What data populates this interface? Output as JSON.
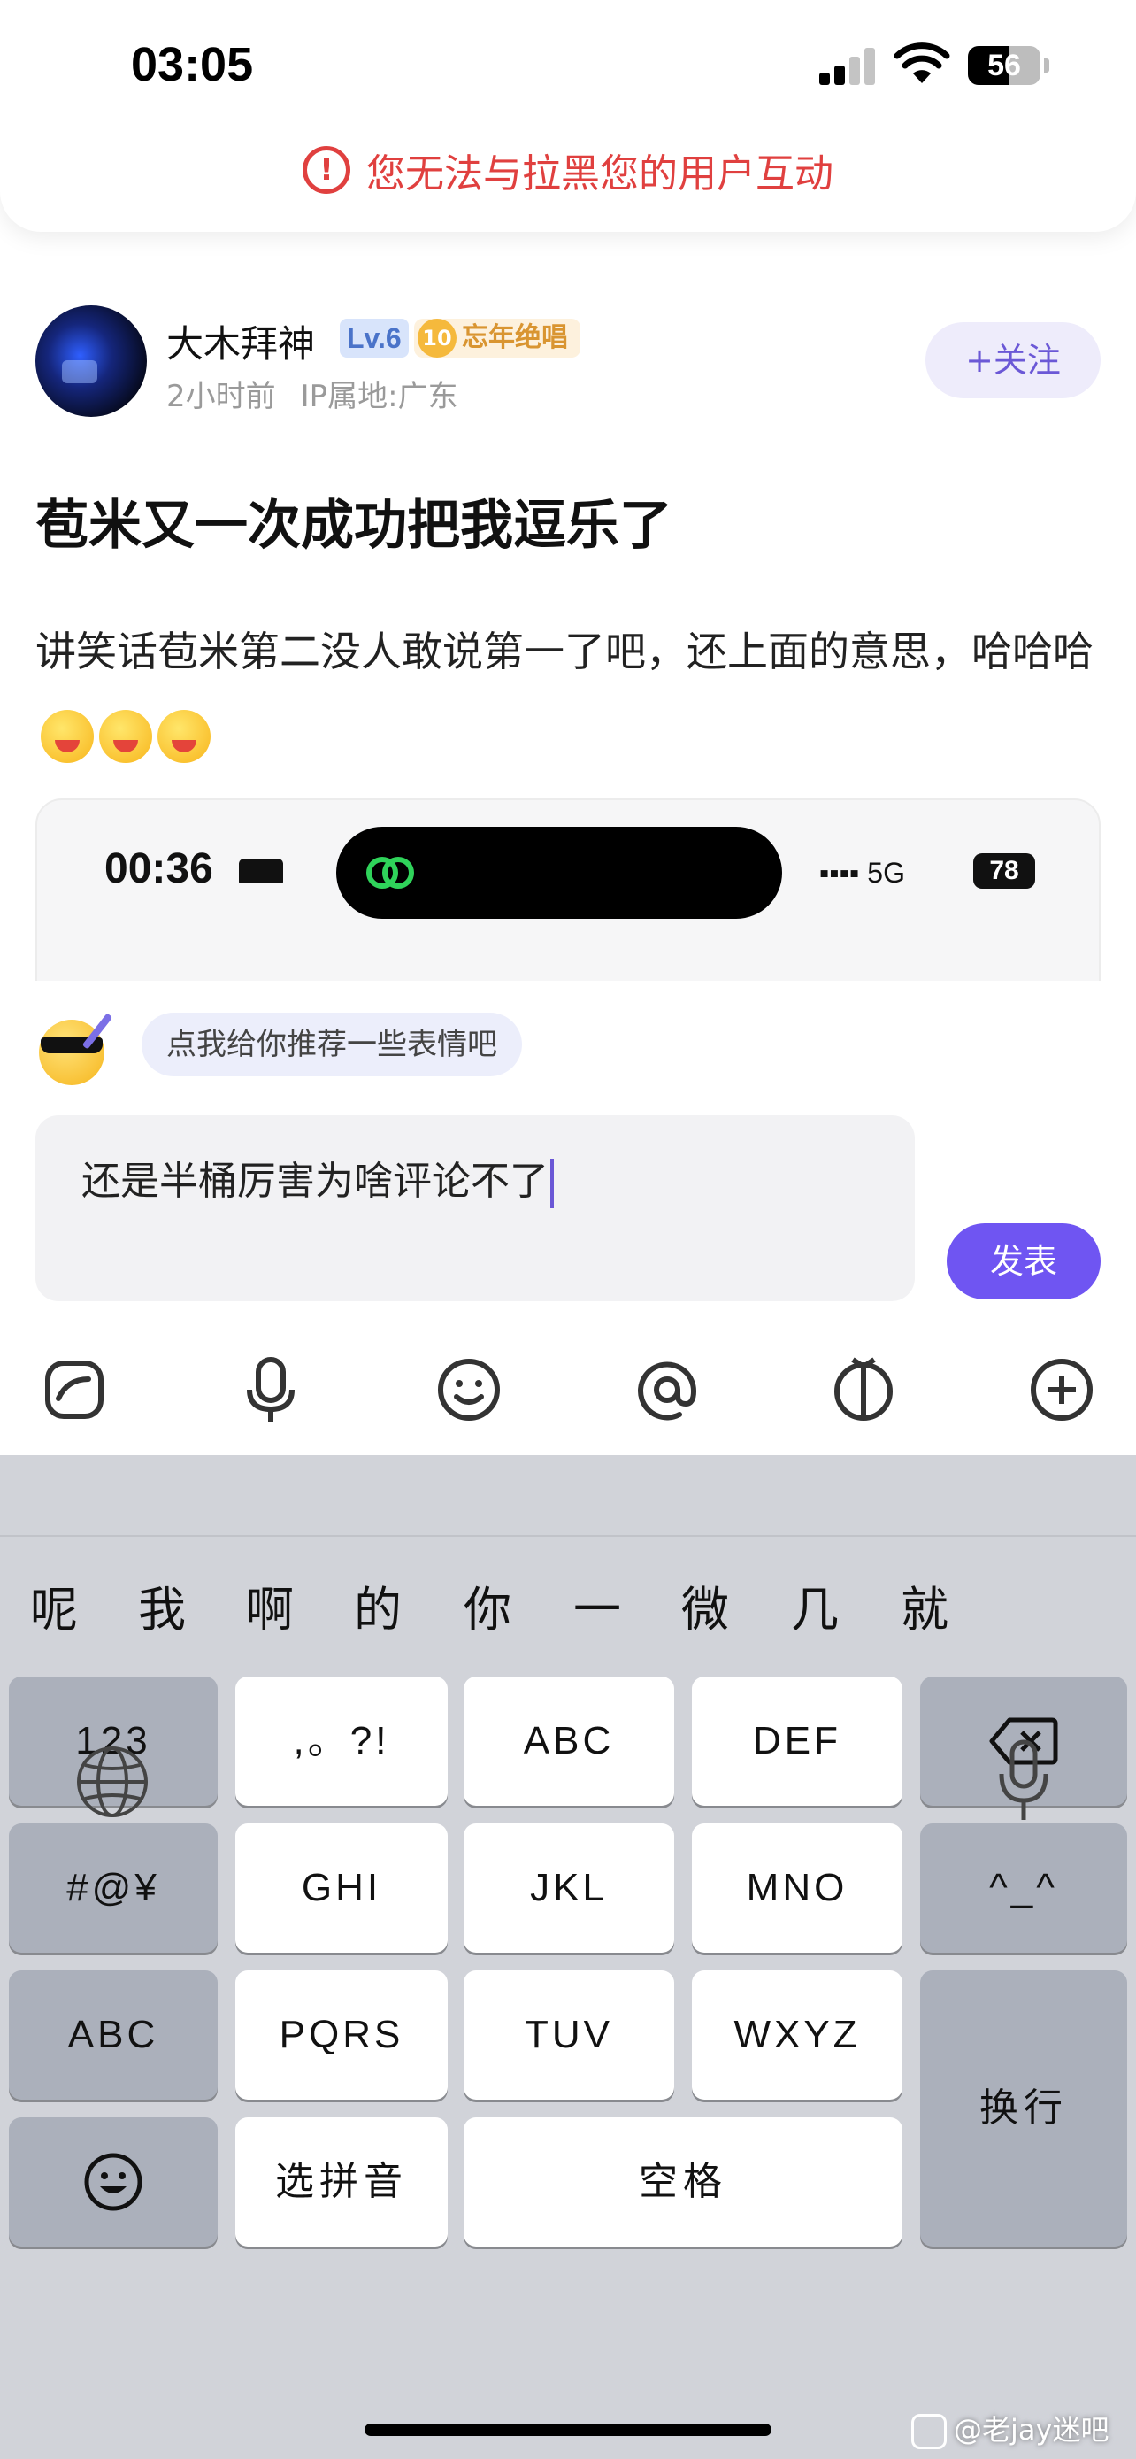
{
  "status_bar": {
    "time": "03:05",
    "battery": "56",
    "battery_level": 0.56
  },
  "toast": {
    "message": "您无法与拉黑您的用户互动",
    "icon": "exclamation-circle-icon"
  },
  "post": {
    "author": "大木拜神",
    "level": "Lv.6",
    "medal_number": "10",
    "medal_label": "忘年绝唱",
    "time": "2小时前",
    "ip_location": "IP属地:广东",
    "follow_label": "+关注",
    "title": "苞米又一次成功把我逗乐了",
    "body": "讲笑话苞米第二没人敢说第一了吧，还上面的意思，哈哈哈",
    "emoji_count": 3
  },
  "embedded_screenshot": {
    "time": "00:36",
    "network": "5G",
    "battery": "78"
  },
  "composer": {
    "suggestion": "点我给你推荐一些表情吧",
    "input_value": "还是半桶厉害为啥评论不了",
    "send_label": "发表",
    "tools": [
      "sticker-icon",
      "microphone-icon",
      "emoji-icon",
      "mention-icon",
      "topic-icon",
      "plus-icon"
    ]
  },
  "keyboard": {
    "candidates": [
      "呢",
      "我",
      "啊",
      "的",
      "你",
      "一",
      "微",
      "几",
      "就"
    ],
    "keys": {
      "num": "123",
      "punct": ",。?!",
      "abc": "ABC",
      "def": "DEF",
      "sym": "#@¥",
      "ghi": "GHI",
      "jkl": "JKL",
      "mno": "MNO",
      "face": "^_^",
      "abc_switch": "ABC",
      "pqrs": "PQRS",
      "tuv": "TUV",
      "wxyz": "WXYZ",
      "enter": "换行",
      "pinyin": "选拼音",
      "space": "空格"
    }
  },
  "watermark": "@老jay迷吧"
}
